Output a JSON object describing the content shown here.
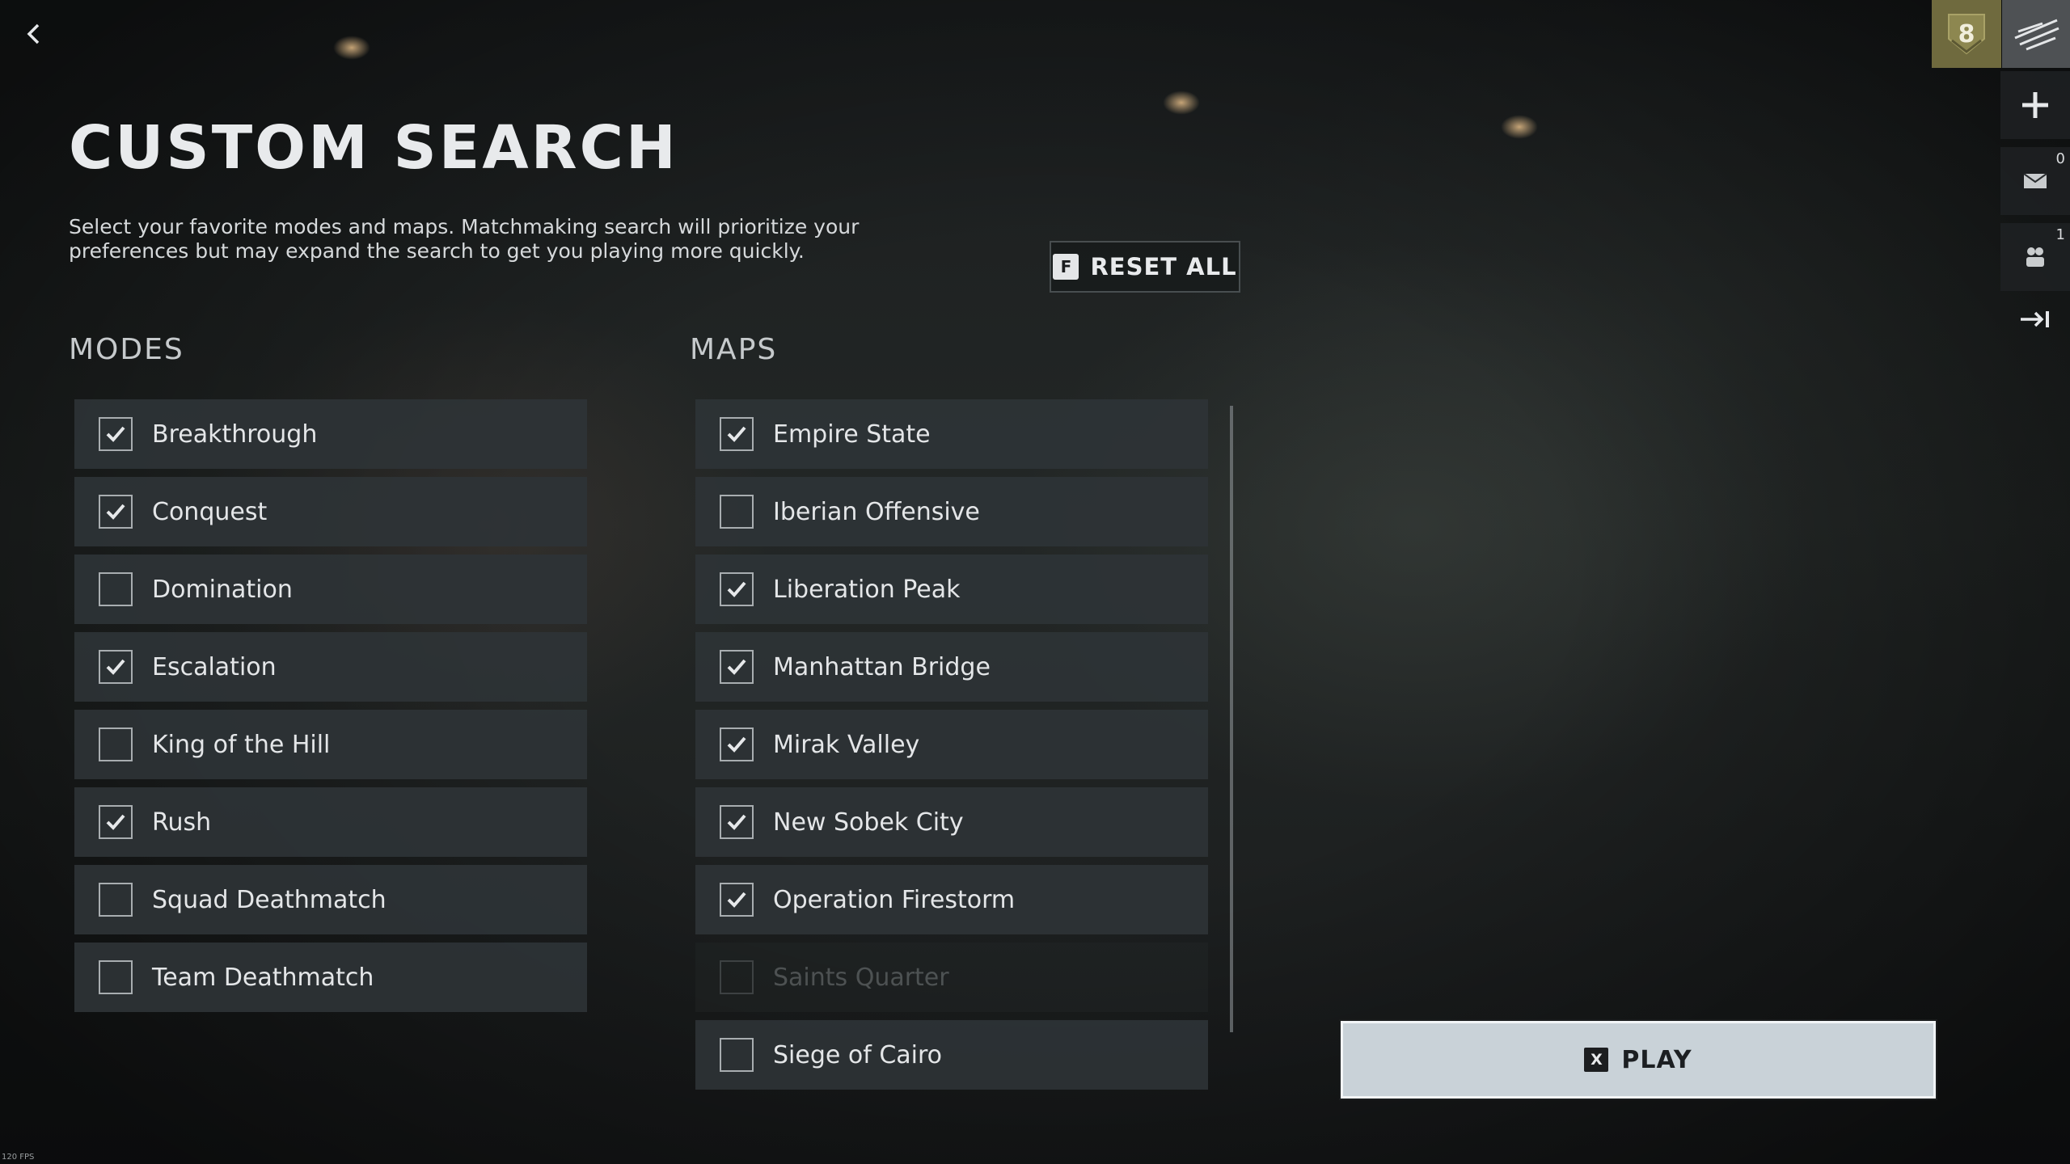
{
  "page": {
    "title": "CUSTOM SEARCH",
    "description": "Select your favorite modes and maps. Matchmaking search will prioritize your preferences but may expand the search to get you playing more quickly."
  },
  "reset": {
    "key": "F",
    "label": "RESET ALL"
  },
  "modes": {
    "title": "MODES",
    "items": [
      {
        "label": "Breakthrough",
        "checked": true
      },
      {
        "label": "Conquest",
        "checked": true
      },
      {
        "label": "Domination",
        "checked": false
      },
      {
        "label": "Escalation",
        "checked": true
      },
      {
        "label": "King of the Hill",
        "checked": false
      },
      {
        "label": "Rush",
        "checked": true
      },
      {
        "label": "Squad Deathmatch",
        "checked": false
      },
      {
        "label": "Team Deathmatch",
        "checked": false
      }
    ]
  },
  "maps": {
    "title": "MAPS",
    "items": [
      {
        "label": "Empire State",
        "checked": true
      },
      {
        "label": "Iberian Offensive",
        "checked": false
      },
      {
        "label": "Liberation Peak",
        "checked": true
      },
      {
        "label": "Manhattan Bridge",
        "checked": true
      },
      {
        "label": "Mirak Valley",
        "checked": true
      },
      {
        "label": "New Sobek City",
        "checked": true
      },
      {
        "label": "Operation Firestorm",
        "checked": true
      },
      {
        "label": "Saints Quarter",
        "checked": false,
        "disabled": true
      },
      {
        "label": "Siege of Cairo",
        "checked": false
      }
    ]
  },
  "play": {
    "key": "X",
    "label": "PLAY"
  },
  "sidebar": {
    "rank": "8",
    "mail_count": "0",
    "friends_count": "1"
  },
  "fps": "120 FPS",
  "icons": {
    "back": "chevron-left-icon",
    "add": "plus-icon",
    "mail": "mail-icon",
    "friends": "friends-icon",
    "exit": "exit-icon",
    "check": "checkmark-icon"
  }
}
